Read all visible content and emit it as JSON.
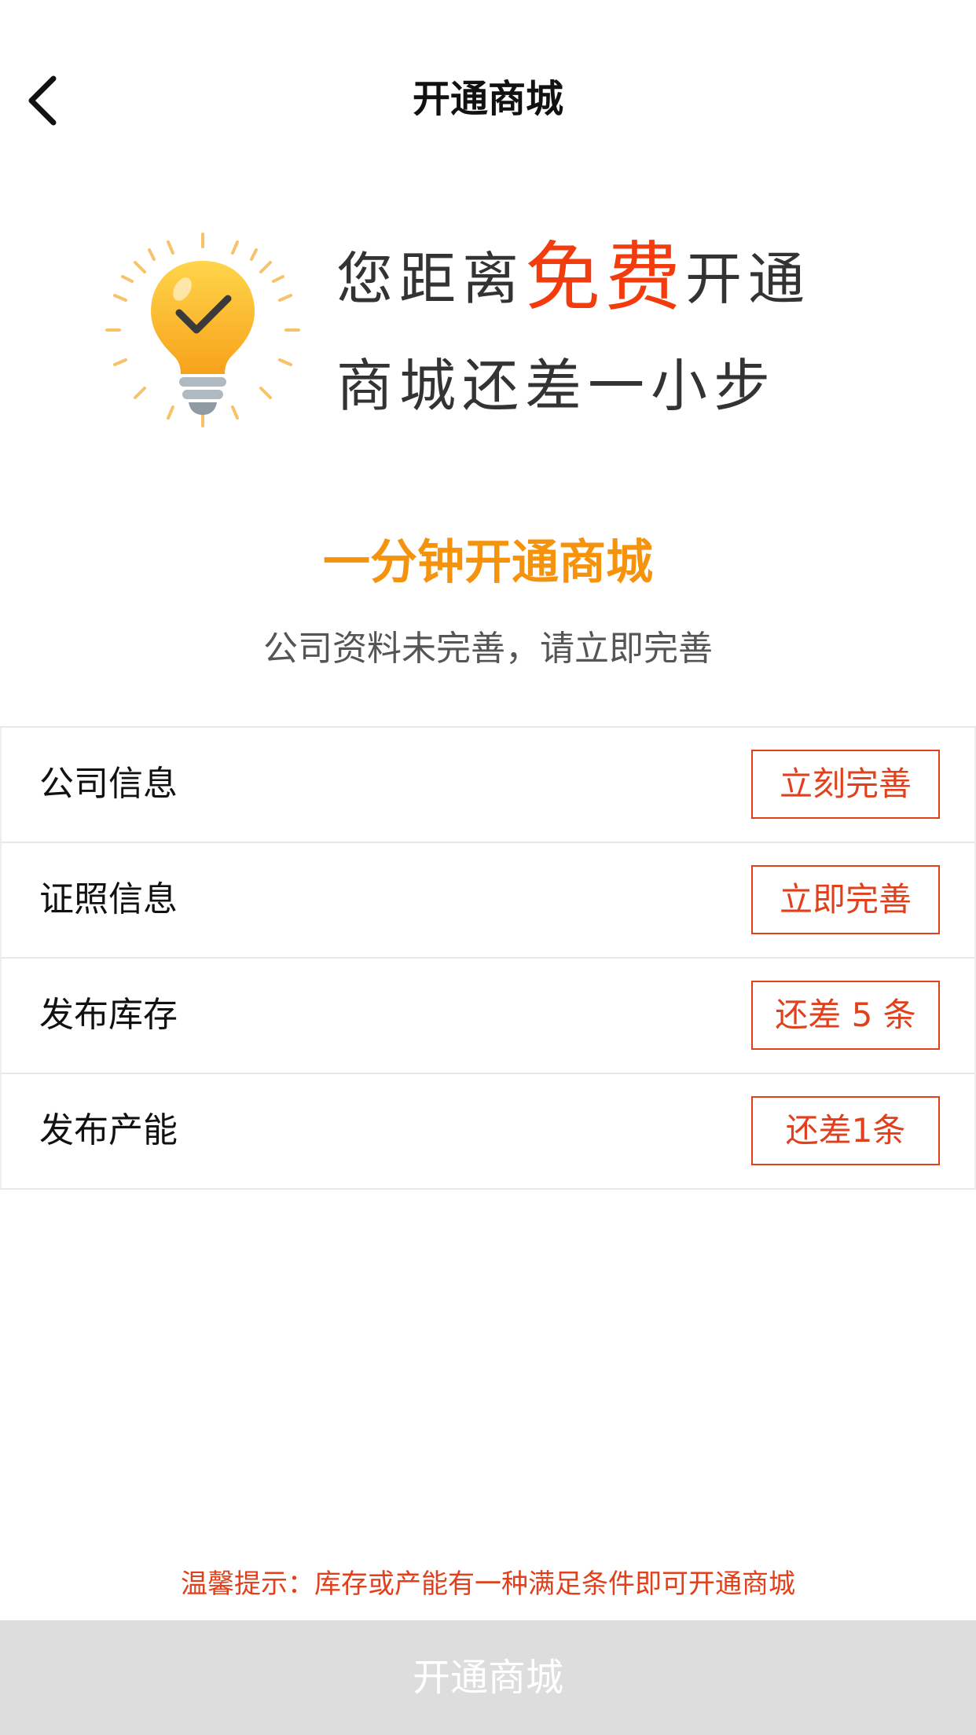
{
  "navbar": {
    "title": "开通商城",
    "back_icon": "chevron-left-icon"
  },
  "hero": {
    "icon": "lightbulb-check-icon",
    "line1_prefix": "您距离",
    "line1_highlight": "免费",
    "line1_suffix": "开通",
    "line2": "商城还差一小步",
    "highlight_color": "#f23c0e"
  },
  "section": {
    "title": "一分钟开通商城",
    "subtitle": "公司资料未完善，请立即完善",
    "title_color": "#f5930c"
  },
  "tasks": [
    {
      "label": "公司信息",
      "action": "立刻完善"
    },
    {
      "label": "证照信息",
      "action": "立即完善"
    },
    {
      "label": "发布库存",
      "action": "还差 5 条"
    },
    {
      "label": "发布产能",
      "action": "还差1条"
    }
  ],
  "tip": "温馨提示：库存或产能有一种满足条件即可开通商城",
  "bottom_button": {
    "label": "开通商城",
    "state": "disabled"
  },
  "colors": {
    "accent_red": "#e0411c",
    "accent_orange": "#f5930c",
    "disabled_bg": "#dddddd"
  }
}
